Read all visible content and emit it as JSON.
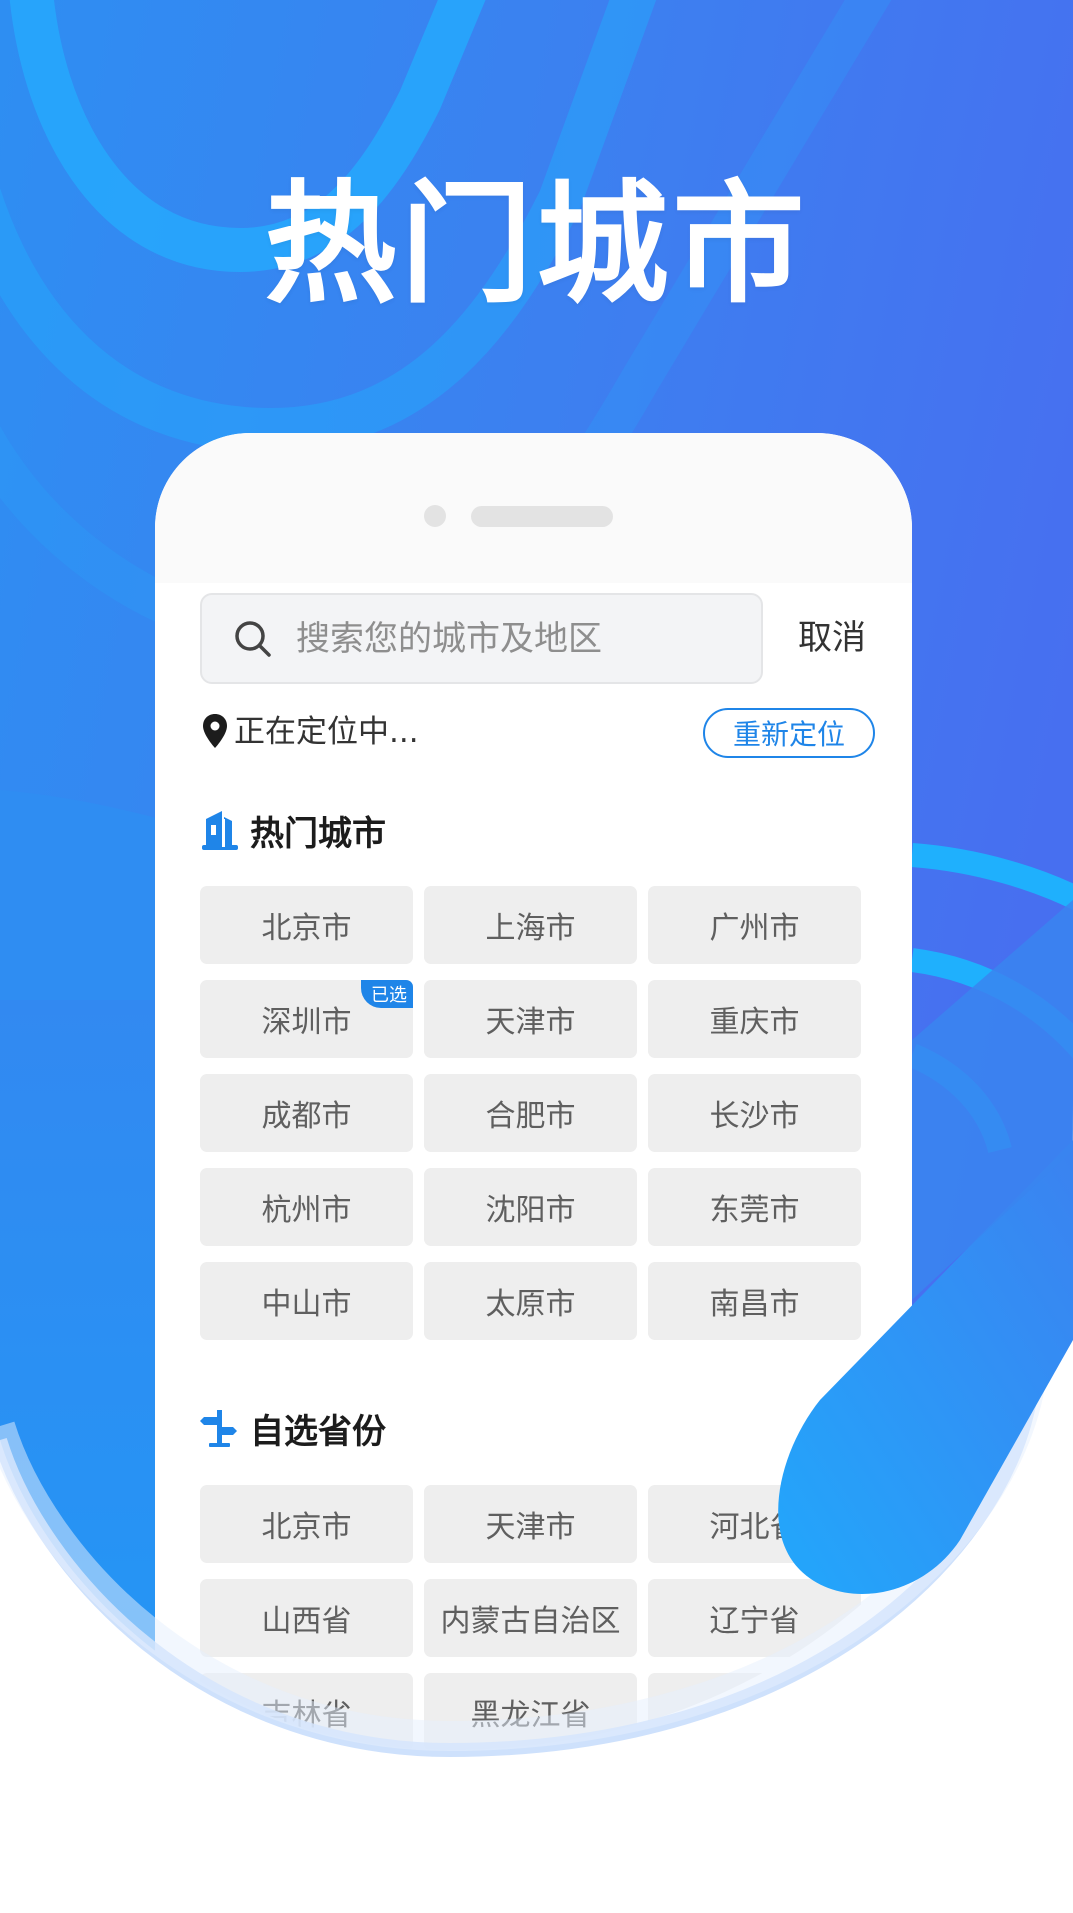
{
  "headline": "热门城市",
  "search": {
    "placeholder": "搜索您的城市及地区",
    "value": "",
    "cancel_label": "取消"
  },
  "location": {
    "status": "正在定位中...",
    "relocate_label": "重新定位"
  },
  "hot_cities": {
    "title": "热门城市",
    "icon": "building-icon",
    "selected_badge": "已选",
    "items": [
      {
        "label": "北京市",
        "selected": false
      },
      {
        "label": "上海市",
        "selected": false
      },
      {
        "label": "广州市",
        "selected": false
      },
      {
        "label": "深圳市",
        "selected": true
      },
      {
        "label": "天津市",
        "selected": false
      },
      {
        "label": "重庆市",
        "selected": false
      },
      {
        "label": "成都市",
        "selected": false
      },
      {
        "label": "合肥市",
        "selected": false
      },
      {
        "label": "长沙市",
        "selected": false
      },
      {
        "label": "杭州市",
        "selected": false
      },
      {
        "label": "沈阳市",
        "selected": false
      },
      {
        "label": "东莞市",
        "selected": false
      },
      {
        "label": "中山市",
        "selected": false
      },
      {
        "label": "太原市",
        "selected": false
      },
      {
        "label": "南昌市",
        "selected": false
      }
    ]
  },
  "provinces": {
    "title": "自选省份",
    "icon": "signpost-icon",
    "items": [
      {
        "label": "北京市"
      },
      {
        "label": "天津市"
      },
      {
        "label": "河北省"
      },
      {
        "label": "山西省"
      },
      {
        "label": "内蒙古自治区"
      },
      {
        "label": "辽宁省"
      },
      {
        "label": "吉林省"
      },
      {
        "label": "黑龙江省"
      },
      {
        "label": ""
      }
    ]
  },
  "colors": {
    "accent": "#1f85e8",
    "background_blue": "#3f7ef0",
    "background_light_blue": "#25a6fb",
    "tile_bg": "#eeeeee",
    "tile_text": "#5f5f5f"
  }
}
